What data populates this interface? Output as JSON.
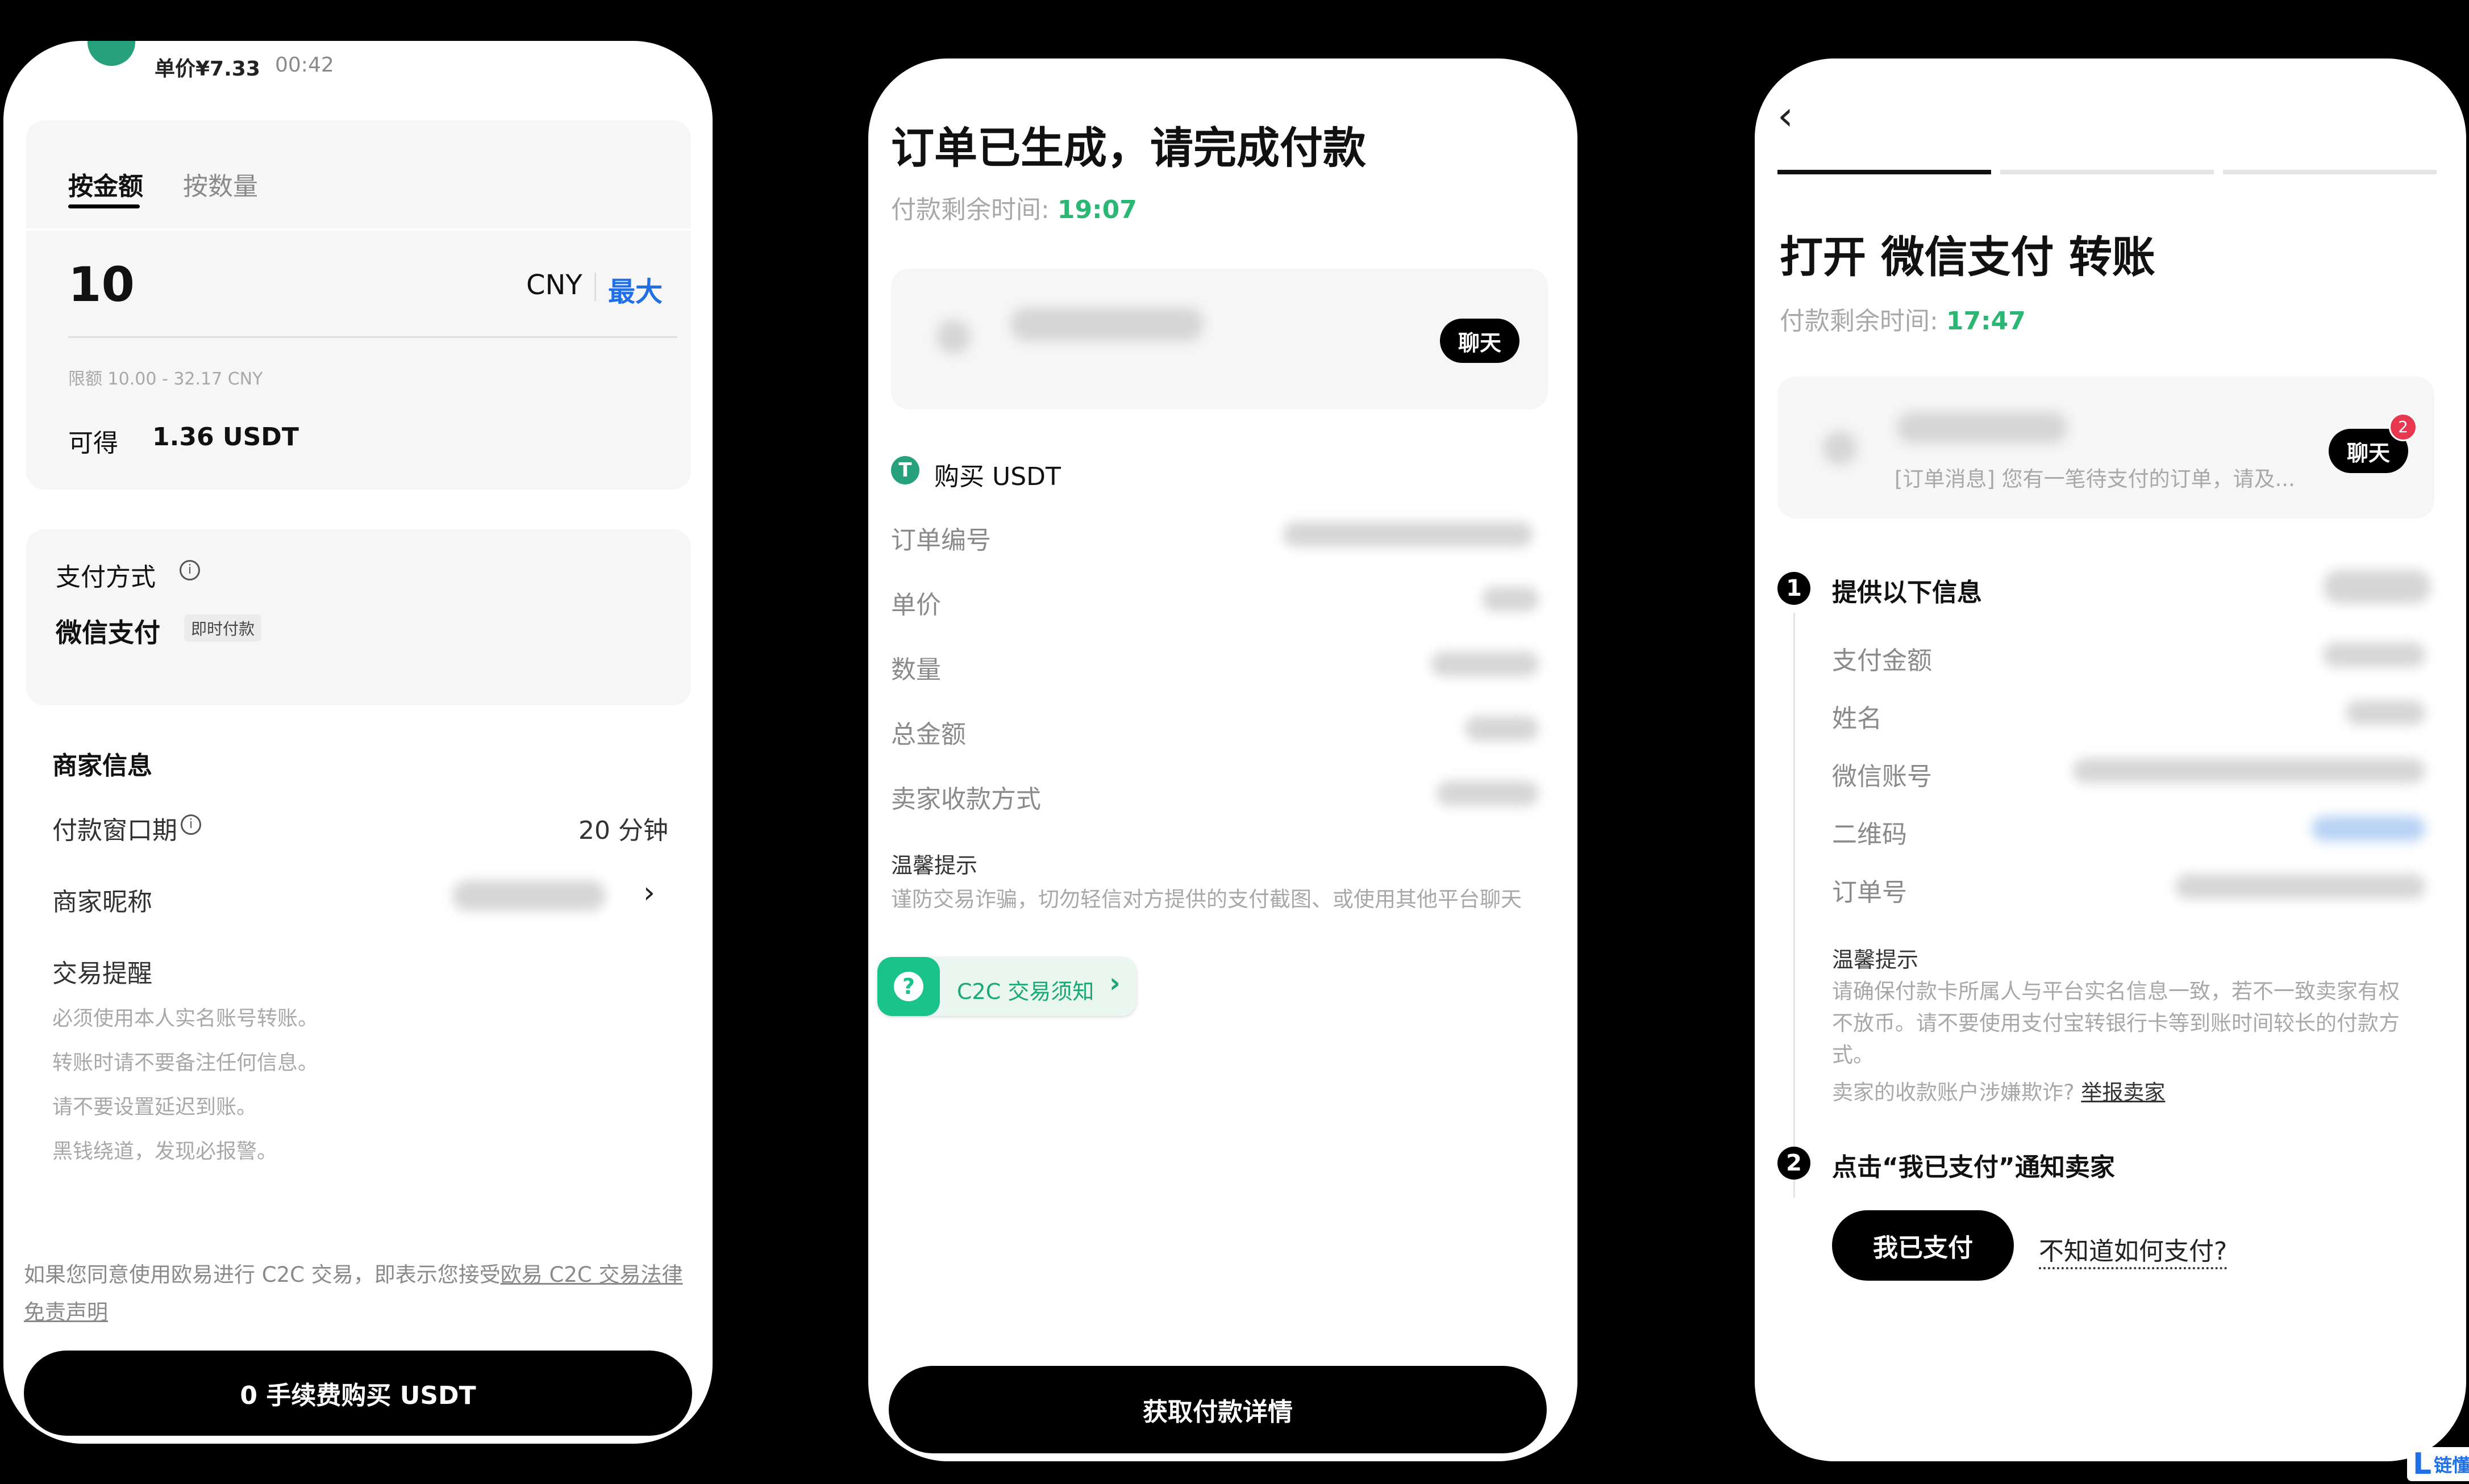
{
  "phone1": {
    "header": {
      "unit_price": "单价¥7.33",
      "time": "00:42"
    },
    "tabs": [
      "按金额",
      "按数量"
    ],
    "amount": {
      "value": "10",
      "currency": "CNY",
      "max_label": "最大"
    },
    "limit_text": "限额 10.00 - 32.17 CNY",
    "receive": {
      "label": "可得",
      "value": "1.36 USDT"
    },
    "payment": {
      "title": "支付方式",
      "method": "微信支付",
      "badge": "即时付款"
    },
    "merchant": {
      "title": "商家信息",
      "window_label": "付款窗口期",
      "window_value": "20 分钟",
      "nickname_label": "商家昵称"
    },
    "reminder": {
      "title": "交易提醒",
      "lines": [
        "必须使用本人实名账号转账。",
        "转账时请不要备注任何信息。",
        "请不要设置延迟到账。",
        "黑钱绕道，发现必报警。"
      ]
    },
    "agreement": {
      "prefix": "如果您同意使用欧易进行 C2C 交易，即表示您接受",
      "link": "欧易 C2C 交易法律",
      "link2": "免责声明"
    },
    "buy_button": "0 手续费购买 USDT"
  },
  "phone2": {
    "title": "订单已生成，请完成付款",
    "countdown_label": "付款剩余时间:",
    "countdown_value": "19:07",
    "chat_label": "聊天",
    "order_title": "购买 USDT",
    "fields": [
      "订单编号",
      "单价",
      "数量",
      "总金额",
      "卖家收款方式"
    ],
    "tip_title": "温馨提示",
    "tip_text": "谨防交易诈骗，切勿轻信对方提供的支付截图、或使用其他平台聊天",
    "c2c_label": "C2C 交易须知",
    "details_button": "获取付款详情"
  },
  "phone3": {
    "title": "打开 微信支付 转账",
    "countdown_label": "付款剩余时间:",
    "countdown_value": "17:47",
    "chat_label": "聊天",
    "chat_badge": "2",
    "order_message": "[订单消息] 您有一笔待支付的订单，请及...",
    "step1_title": "提供以下信息",
    "step1_fields": [
      "支付金额",
      "姓名",
      "微信账号",
      "二维码",
      "订单号"
    ],
    "tip_title": "温馨提示",
    "tip_lines": [
      "请确保付款卡所属人与平台实名信息一致，若不一致卖家有权",
      "不放币。请不要使用支付宝转银行卡等到账时间较长的付款方",
      "式。"
    ],
    "report_prefix": "卖家的收款账户涉嫌欺诈?",
    "report_link": "举报卖家",
    "step2_title": "点击“我已支付”通知卖家",
    "paid_button": "我已支付",
    "howto_link": "不知道如何支付?"
  },
  "watermark": "链懂",
  "colors": {
    "accent_blue": "#1f6fe6",
    "accent_green": "#2bb673",
    "tether_green": "#26a17b",
    "badge_red": "#e8384f"
  }
}
